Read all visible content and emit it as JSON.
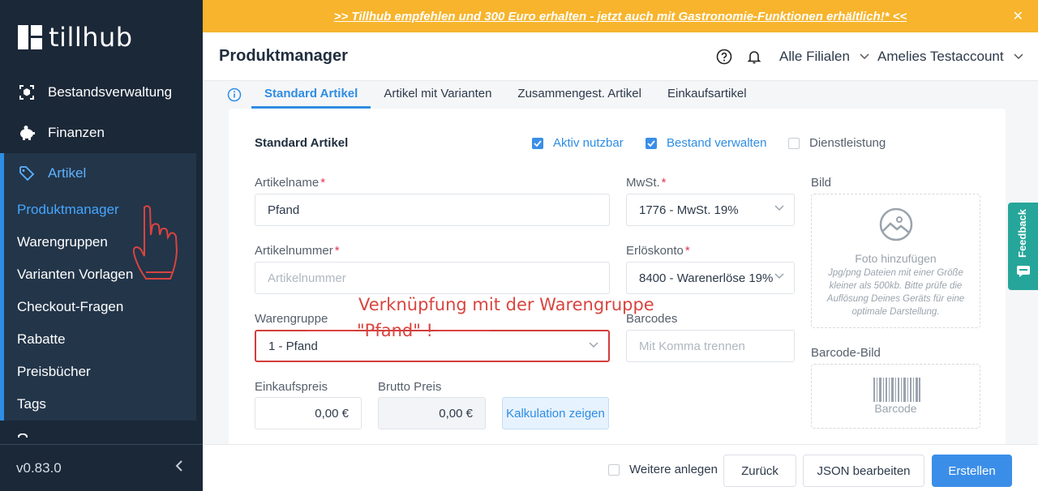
{
  "app": {
    "logo_text": "tillhub",
    "version": "v0.83.0"
  },
  "sidebar": {
    "items": [
      {
        "label": "Bestandsverwaltung",
        "icon": "inventory-icon"
      },
      {
        "label": "Finanzen",
        "icon": "piggy-bank-icon"
      }
    ],
    "group": {
      "label": "Artikel",
      "icon": "tag-icon",
      "subitems": [
        "Produktmanager",
        "Warengruppen",
        "Varianten Vorlagen",
        "Checkout-Fragen",
        "Rabatte",
        "Preisbücher",
        "Tags"
      ],
      "active": "Produktmanager"
    }
  },
  "banner": {
    "text": ">> Tillhub empfehlen und 300 Euro erhalten - jetzt auch mit Gastronomie-Funktionen erhältlich!* <<",
    "close": "✕"
  },
  "header": {
    "title": "Produktmanager",
    "branch": "Alle Filialen",
    "account": "Amelies Testaccount"
  },
  "tabs": [
    "Standard Artikel",
    "Artikel mit Varianten",
    "Zusammengest. Artikel",
    "Einkaufsartikel"
  ],
  "form": {
    "title": "Standard Artikel",
    "checkboxes": {
      "active": "Aktiv nutzbar",
      "stock": "Bestand verwalten",
      "service": "Dienstleistung"
    },
    "name": {
      "label": "Artikelname",
      "value": "Pfand"
    },
    "number": {
      "label": "Artikelnummer",
      "placeholder": "Artikelnummer"
    },
    "group": {
      "label": "Warengruppe",
      "value": "1 - Pfand"
    },
    "purchase_price": {
      "label": "Einkaufspreis",
      "value": "0,00 €"
    },
    "gross_price": {
      "label": "Brutto Preis",
      "value": "0,00 €"
    },
    "calc_button": "Kalkulation zeigen",
    "vat": {
      "label": "MwSt.",
      "value": "1776 - MwSt. 19%"
    },
    "revenue_account": {
      "label": "Erlöskonto",
      "value": "8400 - Warenerlöse 19%"
    },
    "barcodes": {
      "label": "Barcodes",
      "placeholder": "Mit Komma trennen"
    },
    "image": {
      "label": "Bild",
      "title": "Foto hinzufügen",
      "hint": "Jpg/png Dateien mit einer Größe kleiner als 500kb. Bitte prüfe die Auflösung Deines Geräts für eine optimale Darstellung."
    },
    "barcode_image": {
      "label": "Barcode-Bild",
      "placeholder": "Barcode"
    },
    "required_mark": "*"
  },
  "annotation": {
    "line1": "Verknüpfung mit der Warengruppe",
    "line2": "\"Pfand\" !"
  },
  "feedback": "Feedback",
  "footer": {
    "more": "Weitere anlegen",
    "back": "Zurück",
    "json": "JSON bearbeiten",
    "create": "Erstellen"
  },
  "colors": {
    "accent": "#2e8de4",
    "sidebar": "#1b2838",
    "banner": "#f7b42c",
    "annotation": "#d9443f",
    "feedback": "#26a69a"
  }
}
